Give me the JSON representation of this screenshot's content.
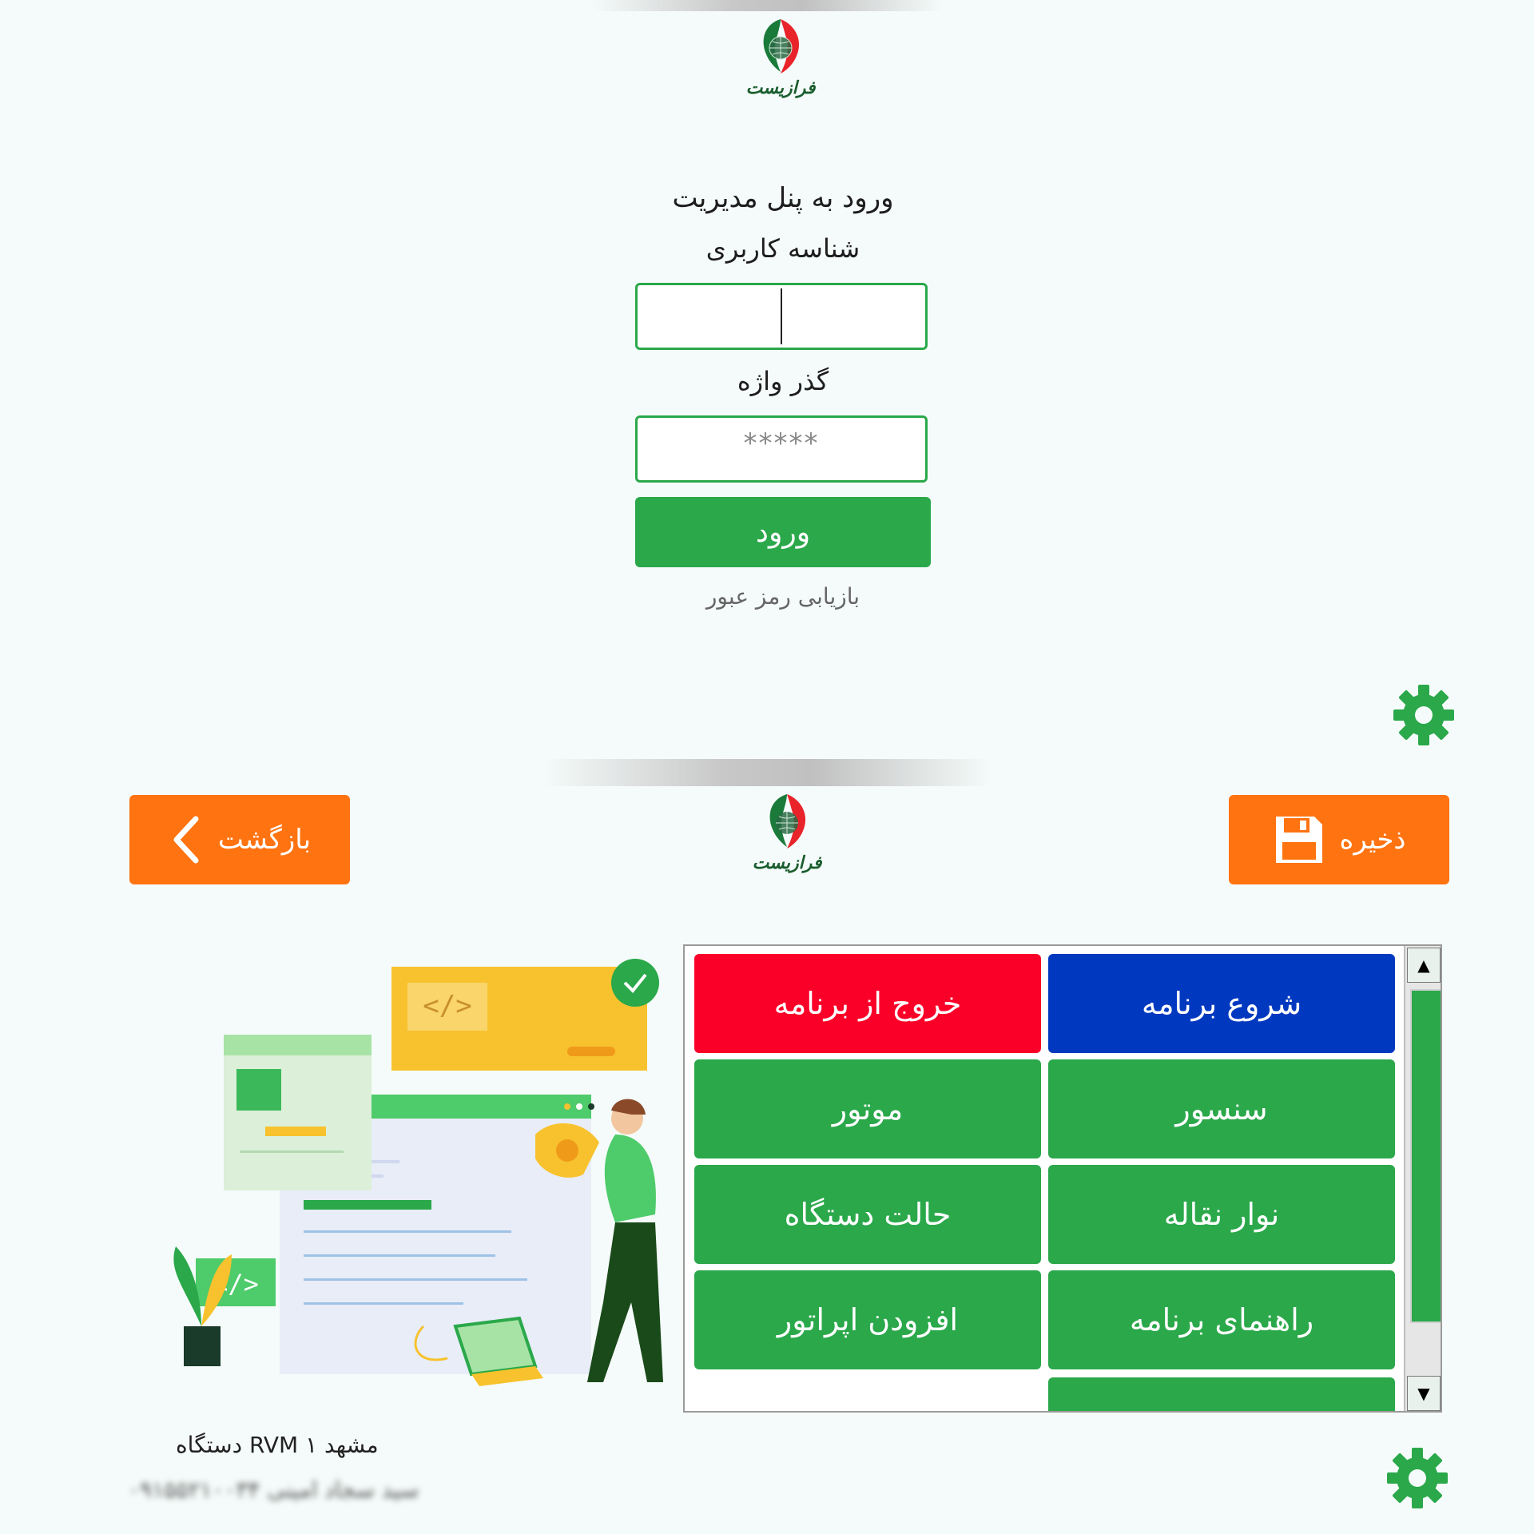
{
  "brand": {
    "name": "فرازیست",
    "colors": {
      "green": "#2aa84a",
      "red": "#e8232a",
      "dark_green": "#1a5d2e"
    }
  },
  "login": {
    "title": "ورود به پنل مدیریت",
    "username_label": "شناسه کاربری",
    "username_value": "",
    "password_label": "گذر واژه",
    "password_value": "*****",
    "submit_label": "ورود",
    "recover_link": "بازیابی رمز عبور"
  },
  "settings_icon": "gear-icon",
  "toolbar": {
    "back_label": "بازگشت",
    "back_icon": "chevron-left-icon",
    "save_label": "ذخیره",
    "save_icon": "floppy-disk-icon",
    "button_color": "#ff7311"
  },
  "menu": {
    "buttons": [
      {
        "label": "شروع برنامه",
        "color": "#0039c0"
      },
      {
        "label": "خروج از برنامه",
        "color": "#fa0028"
      },
      {
        "label": "سنسور",
        "color": "#2aa84a"
      },
      {
        "label": "موتور",
        "color": "#2aa84a"
      },
      {
        "label": "نوار نقاله",
        "color": "#2aa84a"
      },
      {
        "label": "حالت دستگاه",
        "color": "#2aa84a"
      },
      {
        "label": "راهنمای برنامه",
        "color": "#2aa84a"
      },
      {
        "label": "افزودن اپراتور",
        "color": "#2aa84a"
      }
    ]
  },
  "footer": {
    "device_name": "دستگاه RVM مشهد ۱",
    "operator_info": "سید سجاد امینی ۰۹۱۵۵۲۱۰۰۳۴"
  }
}
